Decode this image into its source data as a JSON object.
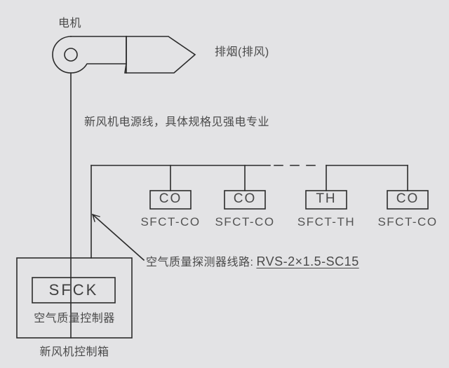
{
  "diagram": {
    "title_label": "电机",
    "exhaust_label": "排烟(排风)",
    "power_line_note": "新风机电源线，具体规格见强电专业",
    "sensor_cable_note_prefix": "空气质量探测器线路:",
    "sensor_cable_spec": "RVS-2×1.5-SC15",
    "controller": {
      "unit_code": "SFCK",
      "unit_name": "空气质量控制器",
      "cabinet_label": "新风机控制箱"
    },
    "sensors": [
      {
        "code": "CO",
        "tag": "SFCT-CO"
      },
      {
        "code": "CO",
        "tag": "SFCT-CO"
      },
      {
        "code": "TH",
        "tag": "SFCT-TH"
      },
      {
        "code": "CO",
        "tag": "SFCT-CO"
      }
    ],
    "colors": {
      "background": "#e3e3e5",
      "line": "#2b2b2b",
      "text": "#4a4a4a"
    }
  }
}
